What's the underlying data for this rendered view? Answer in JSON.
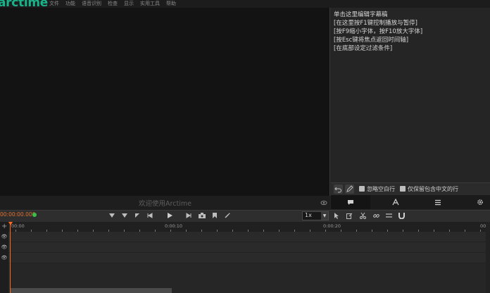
{
  "app": {
    "logo_text": "arctime",
    "menu": [
      "文件",
      "功能",
      "语音识别",
      "检查",
      "显示",
      "实用工具",
      "帮助"
    ]
  },
  "video": {
    "welcome": "欢迎使用Arctime"
  },
  "editor": {
    "lines": [
      "单击这里编辑字幕稿",
      "[在这里按F1键控制播放与暂停]",
      "[按F9缩小字体，按F10放大字体]",
      "[按Esc键将焦点返回时间轴]",
      "[在底部设定过滤条件]"
    ],
    "ignore_empty_label": "忽略空白行",
    "chinese_only_label": "仅保留包含中文的行"
  },
  "panel_tabs": [
    "chat-icon",
    "text-A-icon",
    "list-icon",
    "gear-icon"
  ],
  "transport": {
    "timecode": "00:00:00.000",
    "speed": "1x"
  },
  "timeline": {
    "ruler_labels": [
      "00:00",
      "0:00:10",
      "0:00:20",
      "00:00"
    ]
  }
}
